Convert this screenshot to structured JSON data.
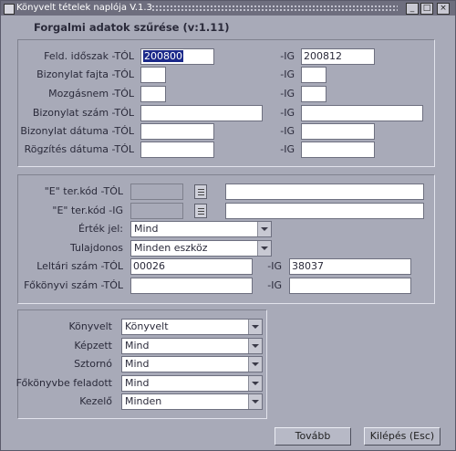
{
  "window": {
    "title": "Könyvelt tételek naplója V.1.3",
    "minimize": "_",
    "maximize": "□",
    "close": "×"
  },
  "header": "Forgalmi adatok szűrése (v:1.11)",
  "section1": {
    "rows": [
      {
        "from_label": "Feld. időszak -TÓL",
        "from_value": "200800",
        "to_label": "-IG",
        "to_value": "200812"
      },
      {
        "from_label": "Bizonylat fajta -TÓL",
        "from_value": "",
        "to_label": "-IG",
        "to_value": ""
      },
      {
        "from_label": "Mozgásnem -TÓL",
        "from_value": "",
        "to_label": "-IG",
        "to_value": ""
      },
      {
        "from_label": "Bizonylat szám -TÓL",
        "from_value": "",
        "to_label": "-IG",
        "to_value": ""
      },
      {
        "from_label": "Bizonylat dátuma -TÓL",
        "from_value": "",
        "to_label": "-IG",
        "to_value": ""
      },
      {
        "from_label": "Rögzítés dátuma -TÓL",
        "from_value": "",
        "to_label": "-IG",
        "to_value": ""
      }
    ]
  },
  "section2": {
    "ter_from_label": "\"E\" ter.kód -TÓL",
    "ter_to_label": "\"E\" ter.kód -IG",
    "ertekjel_label": "Érték jel:",
    "ertekjel_value": "Mind",
    "tulajdonos_label": "Tulajdonos",
    "tulajdonos_value": "Minden eszköz",
    "leltari_from_label": "Leltári szám -TÓL",
    "leltari_from_value": "00026",
    "leltari_to_label": "-IG",
    "leltari_to_value": "38037",
    "fokonyvi_from_label": "Főkönyvi szám -TÓL",
    "fokonyvi_from_value": "",
    "fokonyvi_to_label": "-IG",
    "fokonyvi_to_value": ""
  },
  "section3": {
    "items": [
      {
        "label": "Könyvelt",
        "value": "Könyvelt"
      },
      {
        "label": "Képzett",
        "value": "Mind"
      },
      {
        "label": "Sztornó",
        "value": "Mind"
      },
      {
        "label": "Főkönyvbe feladott",
        "value": "Mind"
      },
      {
        "label": "Kezelő",
        "value": "Minden"
      }
    ]
  },
  "buttons": {
    "next": "Tovább",
    "exit": "Kilépés (Esc)"
  }
}
